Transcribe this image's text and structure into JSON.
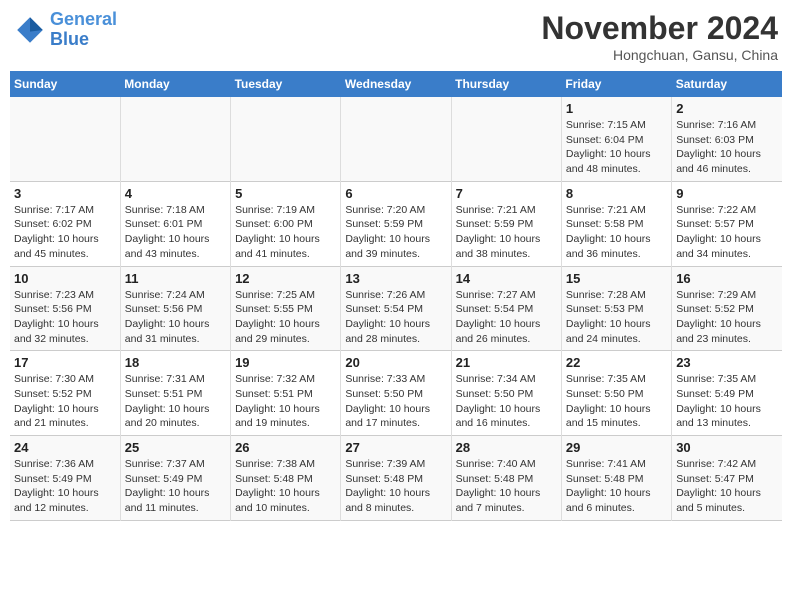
{
  "header": {
    "logo_line1": "General",
    "logo_line2": "Blue",
    "month": "November 2024",
    "location": "Hongchuan, Gansu, China"
  },
  "days_of_week": [
    "Sunday",
    "Monday",
    "Tuesday",
    "Wednesday",
    "Thursday",
    "Friday",
    "Saturday"
  ],
  "weeks": [
    [
      {
        "day": "",
        "info": ""
      },
      {
        "day": "",
        "info": ""
      },
      {
        "day": "",
        "info": ""
      },
      {
        "day": "",
        "info": ""
      },
      {
        "day": "",
        "info": ""
      },
      {
        "day": "1",
        "info": "Sunrise: 7:15 AM\nSunset: 6:04 PM\nDaylight: 10 hours and 48 minutes."
      },
      {
        "day": "2",
        "info": "Sunrise: 7:16 AM\nSunset: 6:03 PM\nDaylight: 10 hours and 46 minutes."
      }
    ],
    [
      {
        "day": "3",
        "info": "Sunrise: 7:17 AM\nSunset: 6:02 PM\nDaylight: 10 hours and 45 minutes."
      },
      {
        "day": "4",
        "info": "Sunrise: 7:18 AM\nSunset: 6:01 PM\nDaylight: 10 hours and 43 minutes."
      },
      {
        "day": "5",
        "info": "Sunrise: 7:19 AM\nSunset: 6:00 PM\nDaylight: 10 hours and 41 minutes."
      },
      {
        "day": "6",
        "info": "Sunrise: 7:20 AM\nSunset: 5:59 PM\nDaylight: 10 hours and 39 minutes."
      },
      {
        "day": "7",
        "info": "Sunrise: 7:21 AM\nSunset: 5:59 PM\nDaylight: 10 hours and 38 minutes."
      },
      {
        "day": "8",
        "info": "Sunrise: 7:21 AM\nSunset: 5:58 PM\nDaylight: 10 hours and 36 minutes."
      },
      {
        "day": "9",
        "info": "Sunrise: 7:22 AM\nSunset: 5:57 PM\nDaylight: 10 hours and 34 minutes."
      }
    ],
    [
      {
        "day": "10",
        "info": "Sunrise: 7:23 AM\nSunset: 5:56 PM\nDaylight: 10 hours and 32 minutes."
      },
      {
        "day": "11",
        "info": "Sunrise: 7:24 AM\nSunset: 5:56 PM\nDaylight: 10 hours and 31 minutes."
      },
      {
        "day": "12",
        "info": "Sunrise: 7:25 AM\nSunset: 5:55 PM\nDaylight: 10 hours and 29 minutes."
      },
      {
        "day": "13",
        "info": "Sunrise: 7:26 AM\nSunset: 5:54 PM\nDaylight: 10 hours and 28 minutes."
      },
      {
        "day": "14",
        "info": "Sunrise: 7:27 AM\nSunset: 5:54 PM\nDaylight: 10 hours and 26 minutes."
      },
      {
        "day": "15",
        "info": "Sunrise: 7:28 AM\nSunset: 5:53 PM\nDaylight: 10 hours and 24 minutes."
      },
      {
        "day": "16",
        "info": "Sunrise: 7:29 AM\nSunset: 5:52 PM\nDaylight: 10 hours and 23 minutes."
      }
    ],
    [
      {
        "day": "17",
        "info": "Sunrise: 7:30 AM\nSunset: 5:52 PM\nDaylight: 10 hours and 21 minutes."
      },
      {
        "day": "18",
        "info": "Sunrise: 7:31 AM\nSunset: 5:51 PM\nDaylight: 10 hours and 20 minutes."
      },
      {
        "day": "19",
        "info": "Sunrise: 7:32 AM\nSunset: 5:51 PM\nDaylight: 10 hours and 19 minutes."
      },
      {
        "day": "20",
        "info": "Sunrise: 7:33 AM\nSunset: 5:50 PM\nDaylight: 10 hours and 17 minutes."
      },
      {
        "day": "21",
        "info": "Sunrise: 7:34 AM\nSunset: 5:50 PM\nDaylight: 10 hours and 16 minutes."
      },
      {
        "day": "22",
        "info": "Sunrise: 7:35 AM\nSunset: 5:50 PM\nDaylight: 10 hours and 15 minutes."
      },
      {
        "day": "23",
        "info": "Sunrise: 7:35 AM\nSunset: 5:49 PM\nDaylight: 10 hours and 13 minutes."
      }
    ],
    [
      {
        "day": "24",
        "info": "Sunrise: 7:36 AM\nSunset: 5:49 PM\nDaylight: 10 hours and 12 minutes."
      },
      {
        "day": "25",
        "info": "Sunrise: 7:37 AM\nSunset: 5:49 PM\nDaylight: 10 hours and 11 minutes."
      },
      {
        "day": "26",
        "info": "Sunrise: 7:38 AM\nSunset: 5:48 PM\nDaylight: 10 hours and 10 minutes."
      },
      {
        "day": "27",
        "info": "Sunrise: 7:39 AM\nSunset: 5:48 PM\nDaylight: 10 hours and 8 minutes."
      },
      {
        "day": "28",
        "info": "Sunrise: 7:40 AM\nSunset: 5:48 PM\nDaylight: 10 hours and 7 minutes."
      },
      {
        "day": "29",
        "info": "Sunrise: 7:41 AM\nSunset: 5:48 PM\nDaylight: 10 hours and 6 minutes."
      },
      {
        "day": "30",
        "info": "Sunrise: 7:42 AM\nSunset: 5:47 PM\nDaylight: 10 hours and 5 minutes."
      }
    ]
  ]
}
